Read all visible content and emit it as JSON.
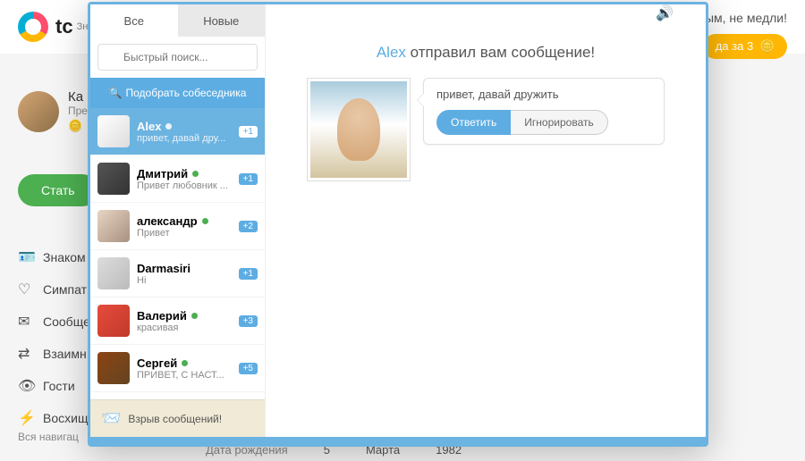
{
  "bg": {
    "logo_text": "tc",
    "logo_sub": "Знa",
    "banner_text": "ым, не медли!",
    "cta_label": "да за 3",
    "profile_name": "Ка",
    "profile_sub": "Пре",
    "green_btn": "Стать",
    "nav": [
      "Знаком",
      "Симпат",
      "Сообще",
      "Взаимн",
      "Гости",
      "Восхищ"
    ],
    "footer_link": "Вся навигац",
    "form_label": "Дата рождения",
    "form_day": "5",
    "form_month": "Марта",
    "form_year": "1982"
  },
  "modal": {
    "tabs": {
      "all": "Все",
      "new": "Новые"
    },
    "search_placeholder": "Быстрый поиск...",
    "match_button": "Подобрать собеседника",
    "contacts": [
      {
        "name": "Alex",
        "preview": "привет, давай дру...",
        "online": true,
        "badge": "+1",
        "selected": true
      },
      {
        "name": "Дмитрий",
        "preview": "Привет любовник ...",
        "online": true,
        "badge": "+1"
      },
      {
        "name": "александр",
        "preview": "Привет",
        "online": true,
        "badge": "+2"
      },
      {
        "name": "Darmasiri",
        "preview": "Hi",
        "online": false,
        "badge": "+1"
      },
      {
        "name": "Валерий",
        "preview": "красивая",
        "online": true,
        "badge": "+3"
      },
      {
        "name": "Сергей",
        "preview": "ПРИВЕТ, С НАСТ...",
        "online": true,
        "badge": "+5"
      }
    ],
    "banner": "Взрыв сообщений!",
    "title_name": "Alex",
    "title_rest": " отправил вам сообщение!",
    "message": "привет, давай дружить",
    "reply_btn": "Ответить",
    "ignore_btn": "Игнорировать"
  }
}
